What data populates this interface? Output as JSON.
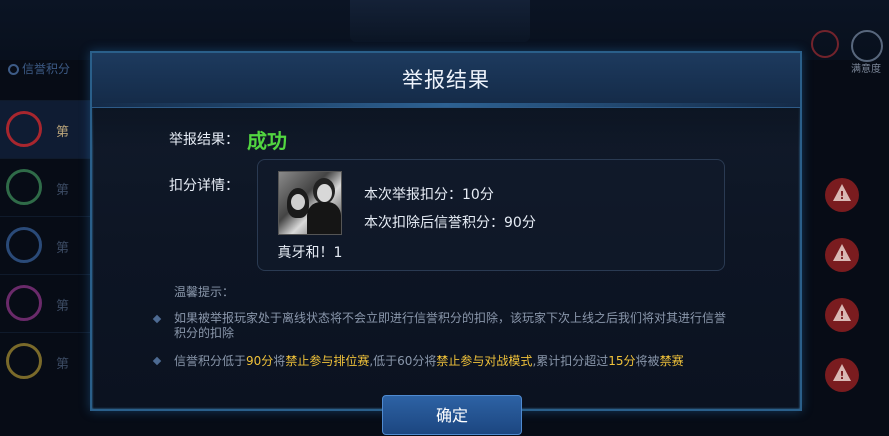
{
  "background": {
    "left_label": "信誉积分",
    "list_items": [
      "第",
      "第",
      "第",
      "第",
      "第"
    ],
    "right_label": "满意度"
  },
  "dialog": {
    "title": "举报结果",
    "result_label": "举报结果：",
    "result_value": "成功",
    "detail_label": "扣分详情：",
    "player_name": "真牙和！1",
    "deduct_line1": "本次举报扣分：10分",
    "deduct_line2": "本次扣除后信誉积分：90分",
    "tips_label": "温馨提示：",
    "tip1": "如果被举报玩家处于离线状态将不会立即进行信誉积分的扣除，该玩家下次上线之后我们将对其进行信誉积分的扣除",
    "tip2": {
      "p1": "信誉积分低于",
      "h1": "90分",
      "p2": "将",
      "h2": "禁止参与排位赛",
      "p3": ",低于60分将",
      "h3": "禁止参与对战模式",
      "p4": ",累计扣分超过",
      "h4": "15分",
      "p5": "将被",
      "h5": "禁赛"
    },
    "confirm_label": "确定"
  },
  "colors": {
    "success": "#52d640",
    "highlight": "#f0c23a",
    "border": "#2a5f8a"
  }
}
